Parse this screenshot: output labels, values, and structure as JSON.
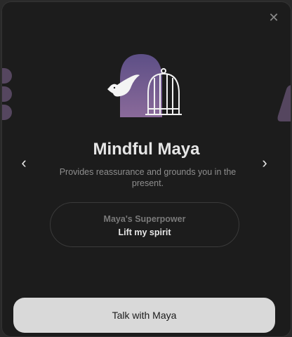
{
  "close_icon": "close-icon",
  "character": {
    "name": "Mindful Maya",
    "description": "Provides reassurance and grounds you in the present."
  },
  "superpower": {
    "label": "Maya's Superpower",
    "value": "Lift my spirit"
  },
  "cta": {
    "label": "Talk with Maya"
  },
  "colors": {
    "background": "#1c1c1c",
    "arch_purple": "#6b5a8e",
    "button": "#d9d9d9",
    "title": "#e6e6e6"
  }
}
